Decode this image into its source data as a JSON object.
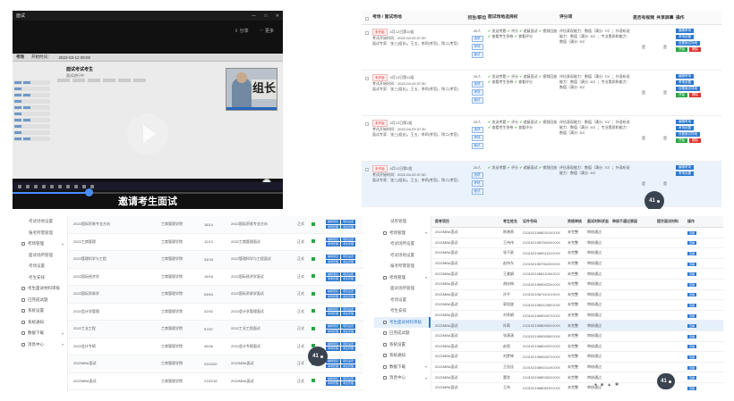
{
  "video": {
    "window_title": "面试",
    "window_controls": [
      "—",
      "□",
      "✕"
    ],
    "toolbar": [
      "分享",
      "更多"
    ],
    "app_bar": [
      "考场",
      "开始时间：",
      "2022-03-12 09:00"
    ],
    "screen_title": "面试考试考生",
    "screen_sub": "面试进行中",
    "sign_text": "组长",
    "progress": 0.28,
    "caption": "邀请考生面试"
  },
  "panel2": {
    "headers": [
      "考场 / 面试场地",
      "招生/职位",
      "面试场地选择权",
      "评分项",
      "是否有视频",
      "共享屏幕",
      "操作"
    ],
    "rows": [
      {
        "tag": "未开始",
        "name": "4月12日第10组",
        "time": "考试开始时间：2022-04-03 07:30",
        "members": "面试专家：张三(组长)、王五、李四(考官)、陈二(考官)",
        "count": "20人",
        "pos_btns": [
          "选项",
          "考场",
          "面试"
        ],
        "rules": [
          "发送考题",
          "评分",
          "遮蔽面试",
          "视频回放",
          "查看考生答卷",
          "查看评分"
        ],
        "eval": "评估表现能力：数值（满分: 70）；外语听说能力：数值（满分: 30）；专业素质和能力：数值（满分: 30）",
        "rec": "是",
        "share": "是",
        "ops": [
          "编辑考场",
          "考场设置",
          "设置面试场地",
          "开始",
          "删除"
        ],
        "selected": false
      },
      {
        "tag": "未开始",
        "name": "4月12日第11组",
        "time": "考试开始时间：2022-04-03 07:30",
        "members": "面试专家：张三(组长)、王五、李四(考官)、陈二(考官)",
        "count": "20人",
        "pos_btns": [
          "选项",
          "考场",
          "面试"
        ],
        "rules": [
          "发送考题",
          "评分",
          "遮蔽面试",
          "视频回放",
          "查看考生答卷",
          "查看评分"
        ],
        "eval": "评估表现能力：数值（满分: 70）；外语听说能力：数值（满分: 30）；专业素质和能力：数值（满分: 30）",
        "rec": "是",
        "share": "是",
        "ops": [
          "编辑考场",
          "考场设置",
          "设置面试场地",
          "开始",
          "删除"
        ],
        "selected": false
      },
      {
        "tag": "未开始",
        "name": "4月12日第1组",
        "time": "考试开始时间：2022-04-03 07:30",
        "members": "面试专家：张三(组长)、王五、李四(考官)、陈二(考官)",
        "count": "20人",
        "pos_btns": [
          "选项",
          "考场",
          "面试"
        ],
        "rules": [
          "发送考题",
          "评分",
          "遮蔽面试",
          "视频回放",
          "查看考生答卷",
          "查看评分"
        ],
        "eval": "评估表现能力：数值（满分: 70）；外语听说能力：数值（满分: 30）；专业素质和能力：数值（满分: 30）",
        "rec": "是",
        "share": "是",
        "ops": [
          "编辑考场",
          "考场设置",
          "设置面试场地",
          "开始",
          "删除"
        ],
        "selected": false
      },
      {
        "tag": "未开始",
        "name": "4月12日第2组",
        "time": "考试开始时间：2022-04-03 07:30",
        "members": "面试专家：张三(组长)、王五、李四(考官)、陈二(考官)",
        "count": "20人",
        "pos_btns": [
          "选项",
          "考场",
          "面试"
        ],
        "rules": [
          "发送考题",
          "评分",
          "遮蔽面试",
          "视频回放"
        ],
        "eval": "评估表现能力：数值（满分: 70）；外语听说能力：数值（满分: 30）",
        "rec": "是",
        "share": "是",
        "ops": [
          "编辑考场",
          "考场设置"
        ],
        "selected": true
      }
    ],
    "sidebar": [
      {
        "label": "考试场所设置",
        "sub": true
      },
      {
        "label": "考试场地设置",
        "sub": true
      },
      {
        "label": "报考所需管理",
        "sub": true
      },
      {
        "label": "考场管理",
        "sub": false,
        "chev": true
      },
      {
        "label": "面试场所管理",
        "sub": true
      },
      {
        "label": "考场设置",
        "sub": true,
        "active": true
      },
      {
        "label": "考生安排",
        "sub": true
      },
      {
        "label": "考生面试材料审核",
        "sub": false
      },
      {
        "label": "已完成试题",
        "sub": false
      },
      {
        "label": "系统设置",
        "sub": false
      },
      {
        "label": "系统通知",
        "sub": false
      },
      {
        "label": "数据下载",
        "sub": false,
        "chev": true
      },
      {
        "label": "消息中心",
        "sub": false,
        "chev": true
      }
    ],
    "bubble": "41"
  },
  "panel3": {
    "sidebar": [
      {
        "label": "考试场地设置",
        "sub": true
      },
      {
        "label": "报考所需管理",
        "sub": true
      },
      {
        "label": "考场管理",
        "sub": false,
        "chev": true
      },
      {
        "label": "面试场所管理",
        "sub": true
      },
      {
        "label": "考场设置",
        "sub": true
      },
      {
        "label": "考生安排",
        "sub": true
      },
      {
        "label": "考生面试材料审核",
        "sub": false
      },
      {
        "label": "已完成试题",
        "sub": false
      },
      {
        "label": "系统设置",
        "sub": false
      },
      {
        "label": "系统通知",
        "sub": false
      },
      {
        "label": "数据下载",
        "sub": false,
        "chev": true
      },
      {
        "label": "消息中心",
        "sub": false,
        "chev": true
      }
    ],
    "rows": [
      {
        "name": "2022国际贸易专业方向",
        "school": "工商管理学院",
        "code": "18/14",
        "proj": "2022国际贸易专业方向",
        "type": "正式"
      },
      {
        "name": "2022工商管理",
        "school": "工商管理学院",
        "code": "12/12",
        "proj": "2022工商管理面试",
        "type": "正式"
      },
      {
        "name": "2022管理科学与工程",
        "school": "工商管理学院",
        "code": "34/34",
        "proj": "2022管理科学与工程面试",
        "type": "正式"
      },
      {
        "name": "2022国际经济学",
        "school": "工商管理学院",
        "code": "16/16",
        "proj": "2022国际经济学面试",
        "type": "正式"
      },
      {
        "name": "2022国际贸易学",
        "school": "工商管理学院",
        "code": "64/64",
        "proj": "2022国际贸易学面试",
        "type": "正式"
      },
      {
        "name": "2022会计学管理",
        "school": "工商管理学院",
        "code": "42/42",
        "proj": "2022会计学管理面试",
        "type": "正式"
      },
      {
        "name": "2022工业工程",
        "school": "工商管理学院",
        "code": "57/57",
        "proj": "2022工业工程面试",
        "type": "正式"
      },
      {
        "name": "2022会计专硕",
        "school": "工商管理学院",
        "code": "46/46",
        "proj": "2022会计专硕面试",
        "type": "正式"
      },
      {
        "name": "2022MBA面试",
        "school": "工商管理学院",
        "code": "220/220",
        "proj": "2022MBA面试",
        "type": "正式"
      },
      {
        "name": "2022MBA面试",
        "school": "工商管理学院",
        "code": "215/218",
        "proj": "2022MBA面试",
        "type": "正式"
      }
    ],
    "ops": [
      "编辑项目",
      "项目设置",
      "考场管理",
      "考生管理"
    ],
    "bubble": "41"
  },
  "panel4": {
    "sidebar": [
      {
        "label": "试卷管理",
        "sub": true
      },
      {
        "label": "考场管理",
        "sub": false,
        "chev": true
      },
      {
        "label": "考试场所设置",
        "sub": true
      },
      {
        "label": "考试场地设置",
        "sub": true
      },
      {
        "label": "报考所需管理",
        "sub": true
      },
      {
        "label": "考场管理",
        "sub": false,
        "chev": true
      },
      {
        "label": "面试场所管理",
        "sub": true
      },
      {
        "label": "考场设置",
        "sub": true
      },
      {
        "label": "考生安排",
        "sub": true
      },
      {
        "label": "考生面试材料审核",
        "sub": false,
        "active": true
      },
      {
        "label": "已完成试题",
        "sub": false
      },
      {
        "label": "系统设置",
        "sub": false
      },
      {
        "label": "系统通知",
        "sub": false
      },
      {
        "label": "数据下载",
        "sub": false,
        "chev": true
      },
      {
        "label": "消息中心",
        "sub": false,
        "chev": true
      }
    ],
    "headers": [
      "报考项目",
      "考生姓名",
      "证件号码",
      "资格审核",
      "面试材料状态",
      "审核不通过原因",
      "提交面试材料",
      "操作"
    ],
    "rows": [
      {
        "proj": "2022MBA面试",
        "name": "陈晓燕",
        "id": "21010219880314XXXX",
        "check": "未完整",
        "status": "审核通过"
      },
      {
        "proj": "2022MBA面试",
        "name": "王伟伟",
        "id": "21010219870624XXXX",
        "check": "未完整",
        "status": "审核通过"
      },
      {
        "proj": "2022MBA面试",
        "name": "张子豪",
        "id": "21010219890101XXXX",
        "check": "未完整",
        "status": "审核通过"
      },
      {
        "proj": "2022MBA面试",
        "name": "赵伟东",
        "id": "21010219870623XXXX",
        "check": "未完整",
        "status": "审核通过"
      },
      {
        "proj": "2022MBA面试",
        "name": "王美娟",
        "id": "21010219881105XXXX",
        "check": "未完整",
        "status": "审核通过"
      },
      {
        "proj": "2022MBA面试",
        "name": "胡庆梅",
        "id": "21010219890523XXXX",
        "check": "未完整",
        "status": "审核通过"
      },
      {
        "proj": "2022MBA面试",
        "name": "孙平",
        "id": "21010219871101XXXX",
        "check": "未完整",
        "status": "审核通过"
      },
      {
        "proj": "2022MBA面试",
        "name": "郭凯旋",
        "id": "21010219891208XXXX",
        "check": "未完整",
        "status": "审核通过"
      },
      {
        "proj": "2022MBA面试",
        "name": "刘季娟",
        "id": "21010219890407XXXX",
        "check": "未完整",
        "status": "审核通过"
      },
      {
        "proj": "2022MBA面试",
        "name": "孙莉",
        "id": "21010219880902XXXX",
        "check": "未完整",
        "status": "审核通过",
        "selected": true
      },
      {
        "proj": "2022MBA面试",
        "name": "张潇潇",
        "id": "21010219890508XXXX",
        "check": "未完整",
        "status": "审核通过"
      },
      {
        "proj": "2022MBA面试",
        "name": "赵雨",
        "id": "21010219880422XXXX",
        "check": "未完整",
        "status": "审核通过"
      },
      {
        "proj": "2022MBA面试",
        "name": "刘梦婷",
        "id": "21010219890407XXXX",
        "check": "未完整",
        "status": "审核通过"
      },
      {
        "proj": "2022MBA面试",
        "name": "王佳佳",
        "id": "21010219891014XXXX",
        "check": "未完整",
        "status": "审核通过"
      },
      {
        "proj": "2022MBA面试",
        "name": "董欣",
        "id": "21010219880302XXXX",
        "check": "未完整",
        "status": "审核通过"
      },
      {
        "proj": "2022MBA面试",
        "name": "王伟",
        "id": "21010219880619XXXX",
        "check": "未完整",
        "status": "审核通过"
      }
    ],
    "op": "查看",
    "bubble": "41"
  }
}
